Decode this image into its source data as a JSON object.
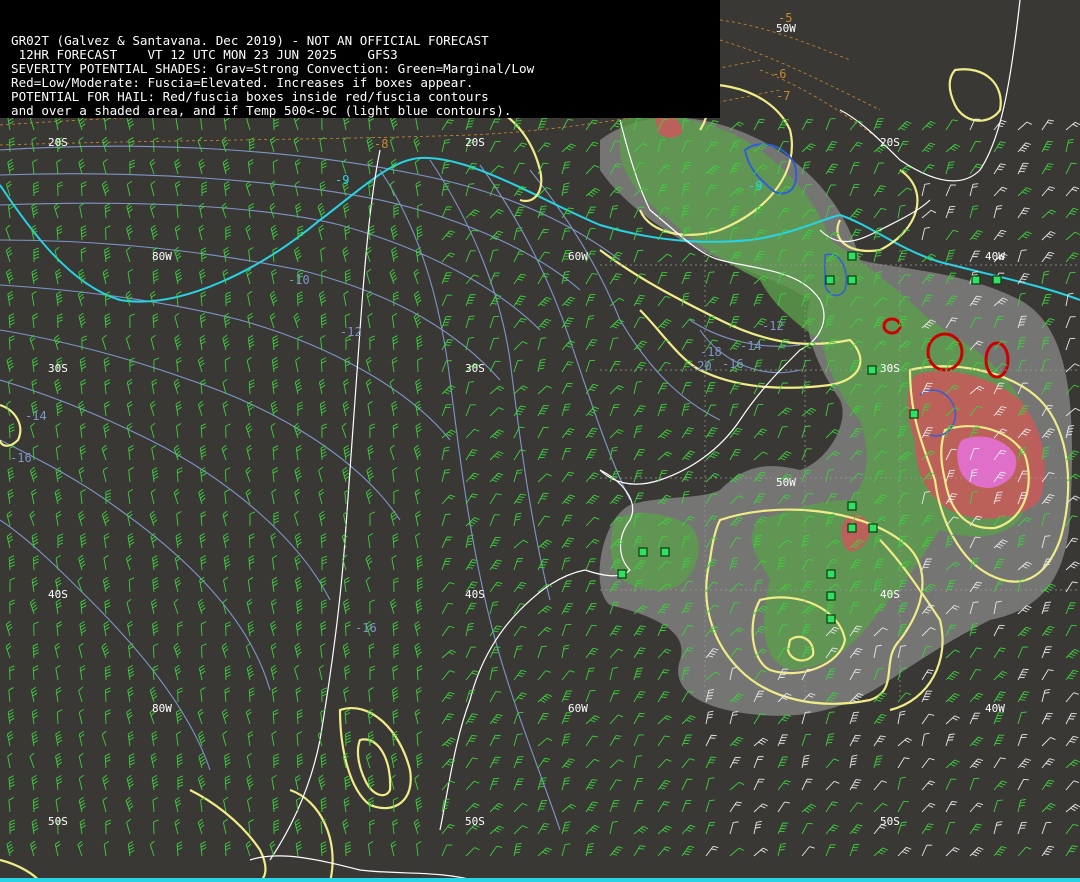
{
  "header": {
    "lines": [
      "GR02T (Galvez & Santavana. Dec 2019) - NOT AN OFFICIAL FORECAST",
      " 12HR FORECAST    VT 12 UTC MON 23 JUN 2025    GFS3",
      "SEVERITY POTENTIAL SHADES: Grav=Strong Convection: Green=Marginal/Low",
      "Red=Low/Moderate: Fuscia=Elevated. Increases if boxes appear.",
      "POTENTIAL FOR HAIL: Red/fuscia boxes inside red/fuscia contours",
      "and over a shaded area, and if Temp 500<-9C (light blue contours)."
    ]
  },
  "grid_labels": {
    "lat_20s_a": "20S",
    "lat_20s_b": "20S",
    "lat_20s_c": "20S",
    "lat_30s_a": "30S",
    "lat_30s_b": "30S",
    "lat_30s_c": "30S",
    "lat_40s_a": "40S",
    "lat_40s_b": "40S",
    "lat_40s_c": "40S",
    "lat_50s_a": "50S",
    "lat_50s_b": "50S",
    "lat_50s_c": "50S",
    "lon_80w_a": "80W",
    "lon_80w_b": "80W",
    "lon_60w_a": "60W",
    "lon_60w_b": "60W",
    "lon_50w_a": "50W",
    "lon_50w_b": "50W",
    "lon_40w_a": "40W",
    "lon_40w_b": "40W"
  },
  "contour_labels": {
    "t_m9_a": "-9",
    "t_m9_b": "-9",
    "t_m10": "-10",
    "t_m12_a": "-12",
    "t_m12_b": "-12",
    "t_m14_a": "-14",
    "t_m14_b": "-14",
    "t_m16_a": "-16",
    "t_m16_b": "-16",
    "t_m18": "-18",
    "t_m20": "-20",
    "t_m16_c": "-16",
    "o_m5": "-5",
    "o_m6": "-6",
    "o_m7": "-7",
    "o_m8": "-8"
  },
  "colors": {
    "background": "#3a3835",
    "coast": "#ffffff",
    "temp500_contour": "#26d4e6",
    "thickness_contour": "#7f95c8",
    "dashed_contour": "#c98a2a",
    "severity_gray": "#8a8a8a",
    "severity_green": "#5d9e4b",
    "severity_red": "#c75b5b",
    "severity_fuscia": "#e070d0",
    "cape_contour": "#f0ec88",
    "hail_contour": "#cc0000",
    "wind_barb": "#3fcf3f",
    "box_fill": "#30e060"
  }
}
